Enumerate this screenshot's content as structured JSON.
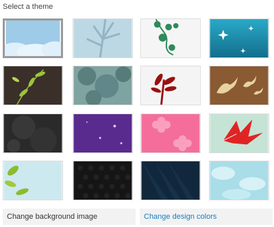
{
  "header": {
    "title": "Select a theme"
  },
  "themes": [
    {
      "icon": "clouds-sky-theme",
      "color": "#a8d0ea",
      "selected": true
    },
    {
      "icon": "bare-tree-theme",
      "color": "#bcd6e2"
    },
    {
      "icon": "green-vine-theme",
      "color": "#f4f4f4"
    },
    {
      "icon": "sparkle-teal-theme",
      "color": "#1fa6c6"
    },
    {
      "icon": "leaves-dark-theme",
      "color": "#3b2f2a"
    },
    {
      "icon": "foliage-teal-theme",
      "color": "#86a7a5"
    },
    {
      "icon": "red-plant-theme",
      "color": "#f2f2f2"
    },
    {
      "icon": "birds-brown-theme",
      "color": "#8a5a33"
    },
    {
      "icon": "grunge-dark-theme",
      "color": "#2a2a2a"
    },
    {
      "icon": "purple-sparkle-theme",
      "color": "#5a2b8e"
    },
    {
      "icon": "pink-flowers-theme",
      "color": "#f56e9b"
    },
    {
      "icon": "red-leaf-theme",
      "color": "#c6e4d6"
    },
    {
      "icon": "light-leaves-theme",
      "color": "#cde9f0"
    },
    {
      "icon": "dark-hex-theme",
      "color": "#151515"
    },
    {
      "icon": "dark-rays-theme",
      "color": "#11283c"
    },
    {
      "icon": "soft-clouds-theme",
      "color": "#a9dde8"
    }
  ],
  "actions": {
    "background_label": "Change background image",
    "colors_label": "Change design colors",
    "link_color": "#1b7fbd"
  }
}
